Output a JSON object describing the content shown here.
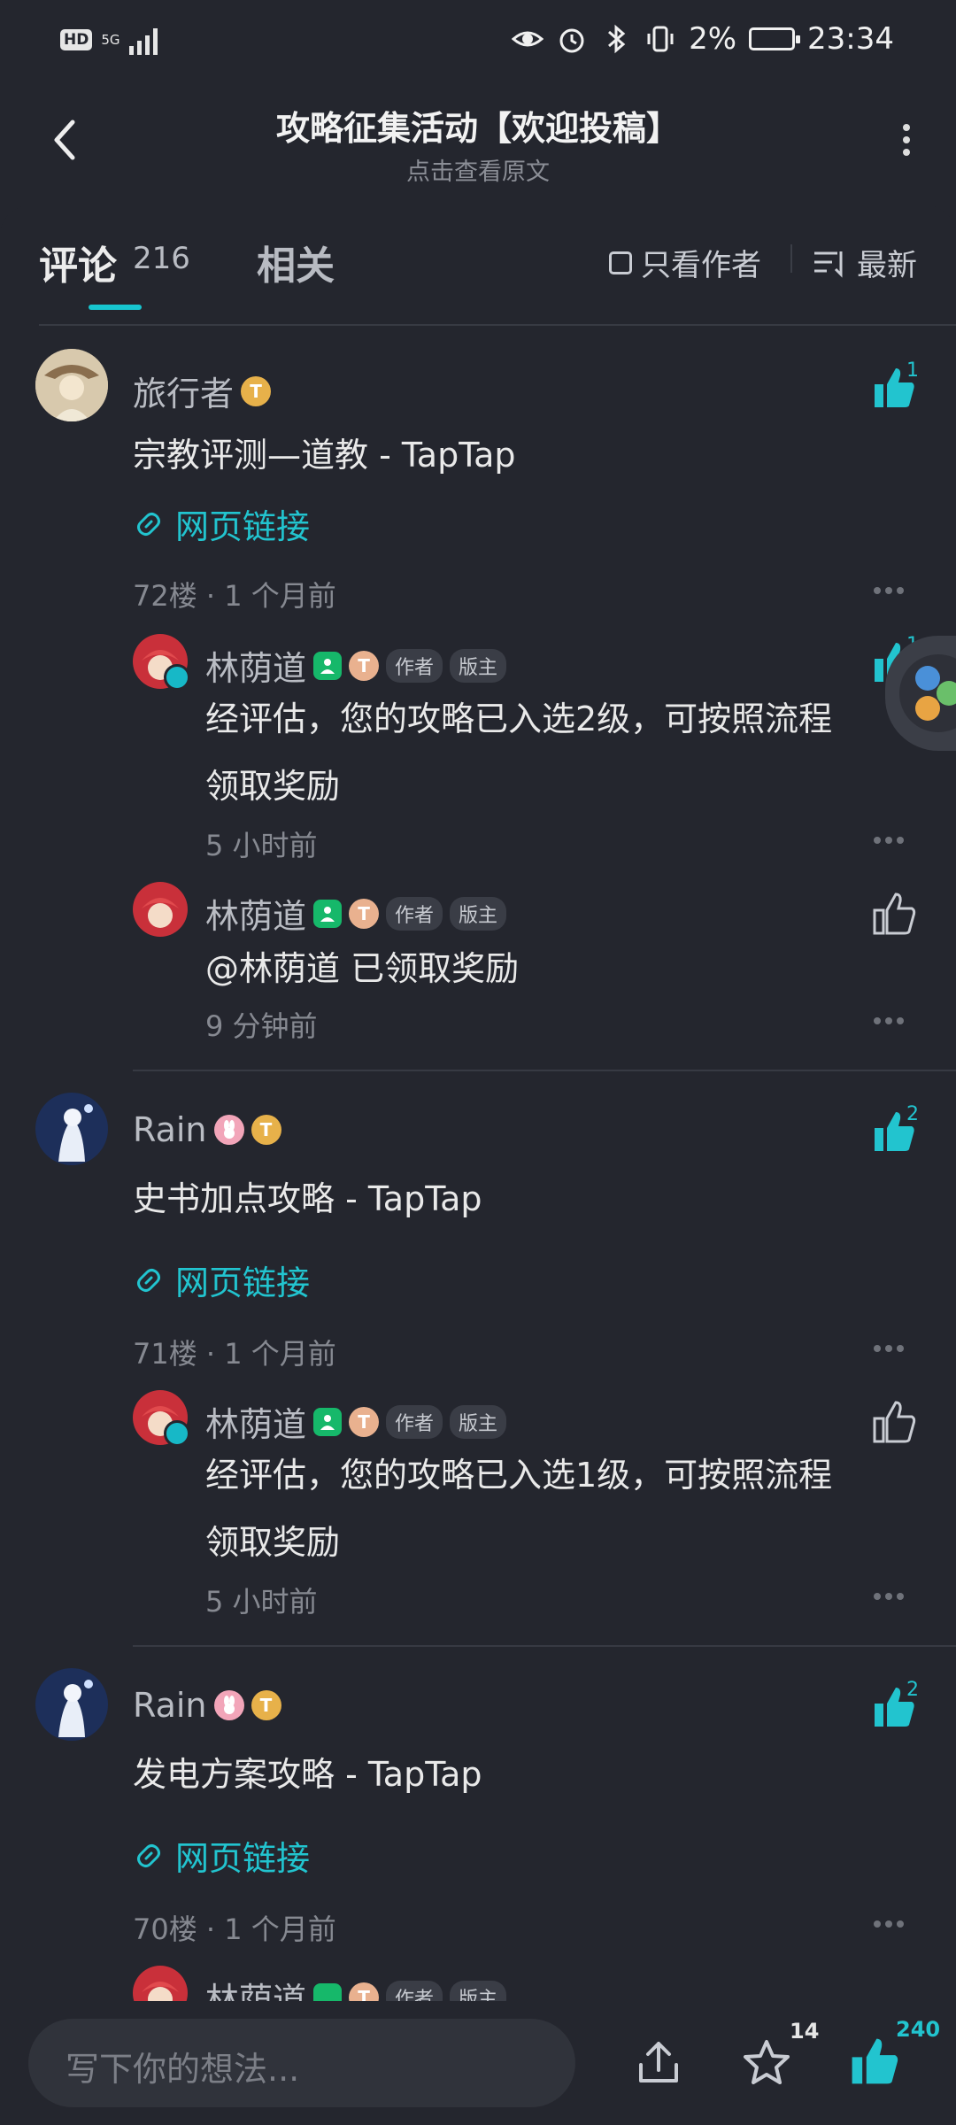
{
  "status": {
    "network": "5G",
    "hd": "HD",
    "battery": "2%",
    "time": "23:34"
  },
  "header": {
    "title": "攻略征集活动【欢迎投稿】",
    "subtitle": "点击查看原文"
  },
  "tabs": {
    "comments_label": "评论",
    "comments_count": "216",
    "related_label": "相关",
    "author_only": "只看作者",
    "sort": "最新"
  },
  "tags": {
    "author": "作者",
    "moderator": "版主",
    "coin": "T"
  },
  "comments": [
    {
      "user": "旅行者",
      "text": "宗教评测—道教 - TapTap",
      "link": "网页链接",
      "meta": "72楼 · 1 个月前",
      "likes": "1",
      "replies": [
        {
          "user": "林荫道",
          "text_line1": "经评估，您的攻略已入选2级，可按照流程",
          "text_line2": "领取奖励",
          "time": "5 小时前",
          "likes": "1"
        },
        {
          "user": "林荫道",
          "text_line1": "@林荫道  已领取奖励",
          "time": "9 分钟前"
        }
      ]
    },
    {
      "user": "Rain",
      "text": "史书加点攻略 - TapTap",
      "link": "网页链接",
      "meta": "71楼 · 1 个月前",
      "likes": "2",
      "replies": [
        {
          "user": "林荫道",
          "text_line1": "经评估，您的攻略已入选1级，可按照流程",
          "text_line2": "领取奖励",
          "time": "5 小时前"
        }
      ]
    },
    {
      "user": "Rain",
      "text": "发电方案攻略 - TapTap",
      "link": "网页链接",
      "meta": "70楼 · 1 个月前",
      "likes": "2",
      "replies": [
        {
          "user": "林荫道"
        }
      ]
    }
  ],
  "bottom": {
    "placeholder": "写下你的想法...",
    "star_count": "14",
    "like_count": "240"
  },
  "colors": {
    "background": "#24262e",
    "accent": "#17c5cf",
    "text": "#e9e9e9",
    "muted": "#868991"
  }
}
